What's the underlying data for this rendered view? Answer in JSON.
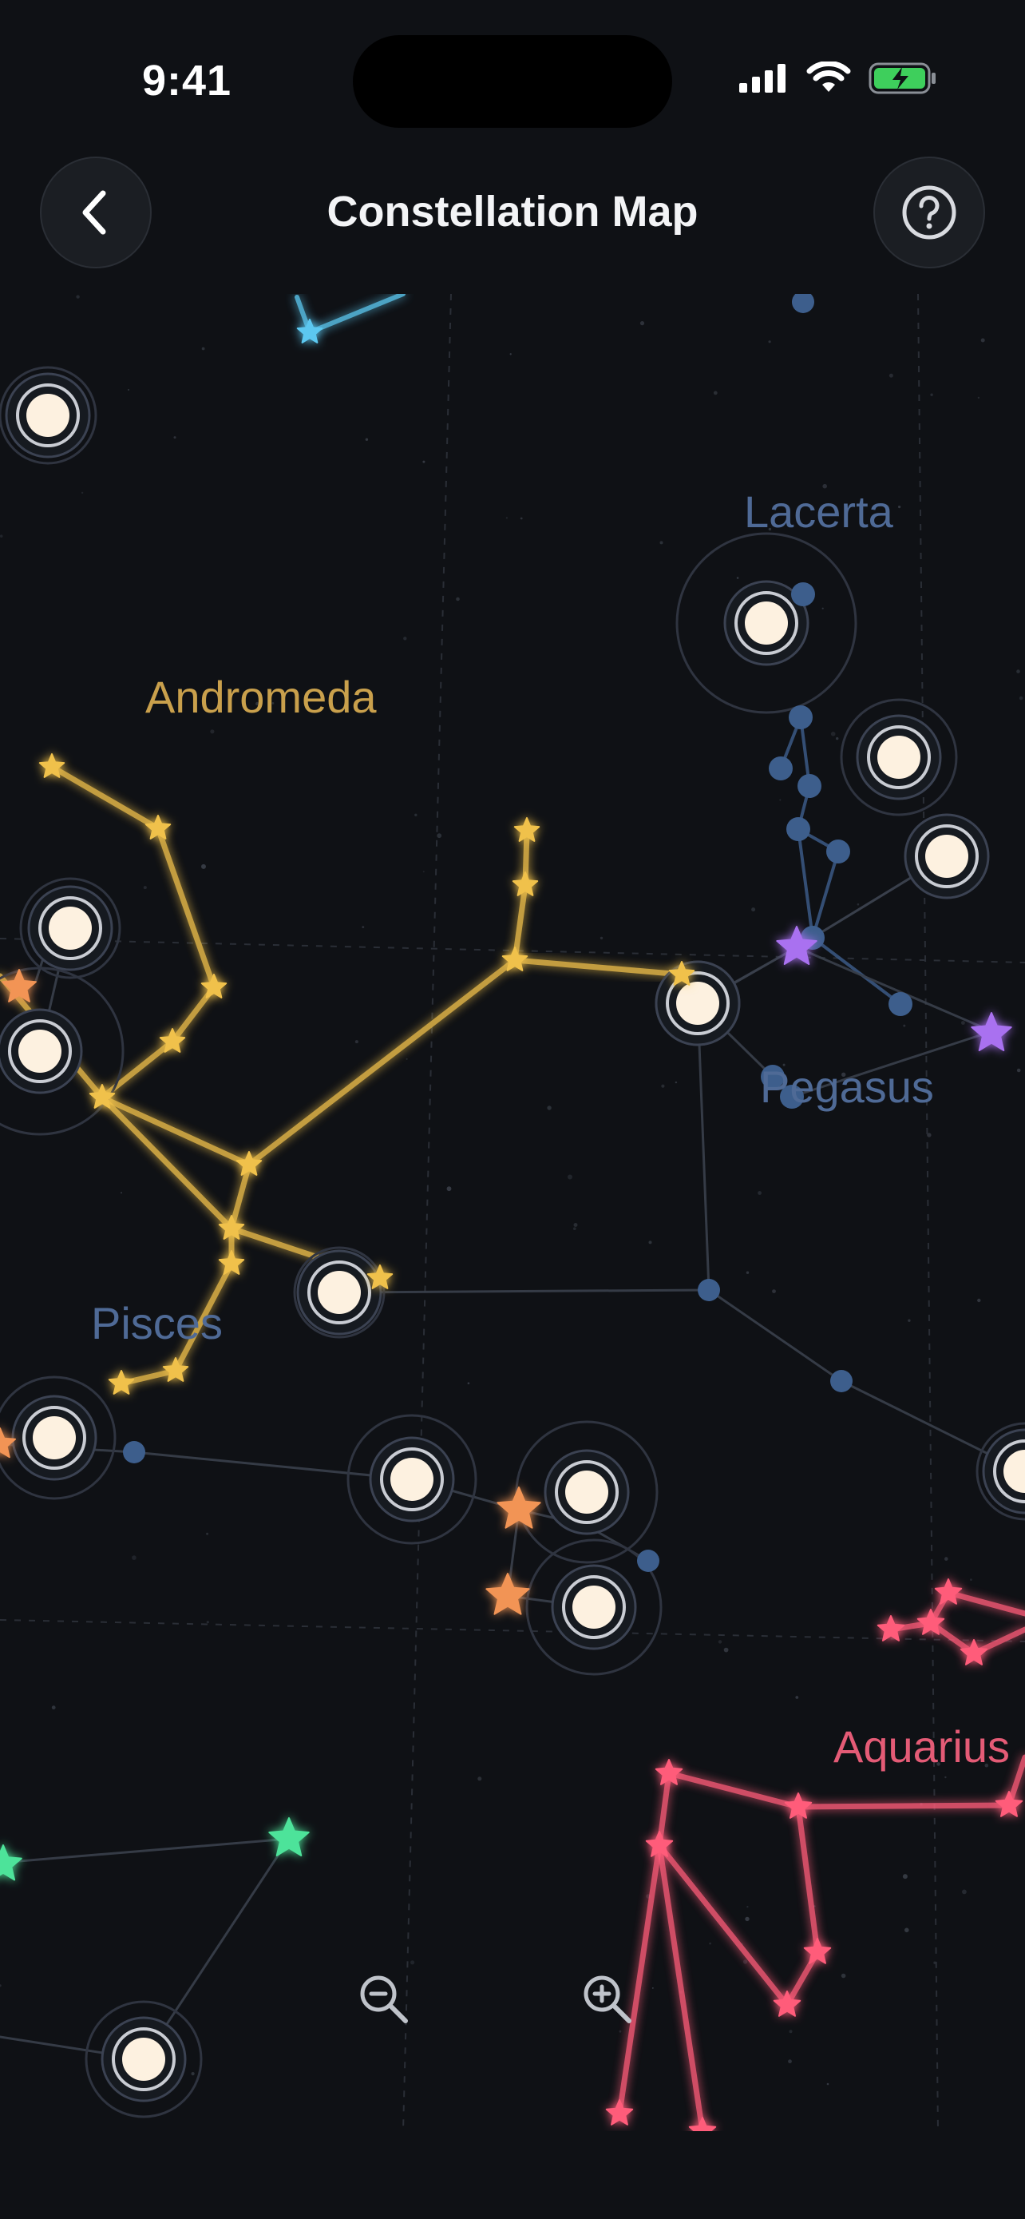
{
  "status_bar": {
    "time": "9:41"
  },
  "header": {
    "title": "Constellation Map"
  },
  "constellations": {
    "andromeda": "Andromeda",
    "lacerta": "Lacerta",
    "pegasus": "Pegasus",
    "pisces": "Pisces",
    "aquarius": "Aquarius"
  },
  "colors": {
    "background": "#0f1115",
    "andromeda": "#f0c14b",
    "lacerta": "#3d5e8c",
    "pegasus": "#a971f0",
    "aquarius": "#ff5c7a",
    "orange": "#f29455",
    "green": "#4ee39a",
    "cyan": "#5cc8f0",
    "label_blue": "#4f6a96",
    "label_gold": "#c9a04c",
    "label_pink": "#e45b76"
  },
  "icons": [
    "back-chevron-icon",
    "help-icon",
    "zoom-out-icon",
    "zoom-in-icon",
    "signal-icon",
    "wifi-icon",
    "battery-charging-icon"
  ]
}
